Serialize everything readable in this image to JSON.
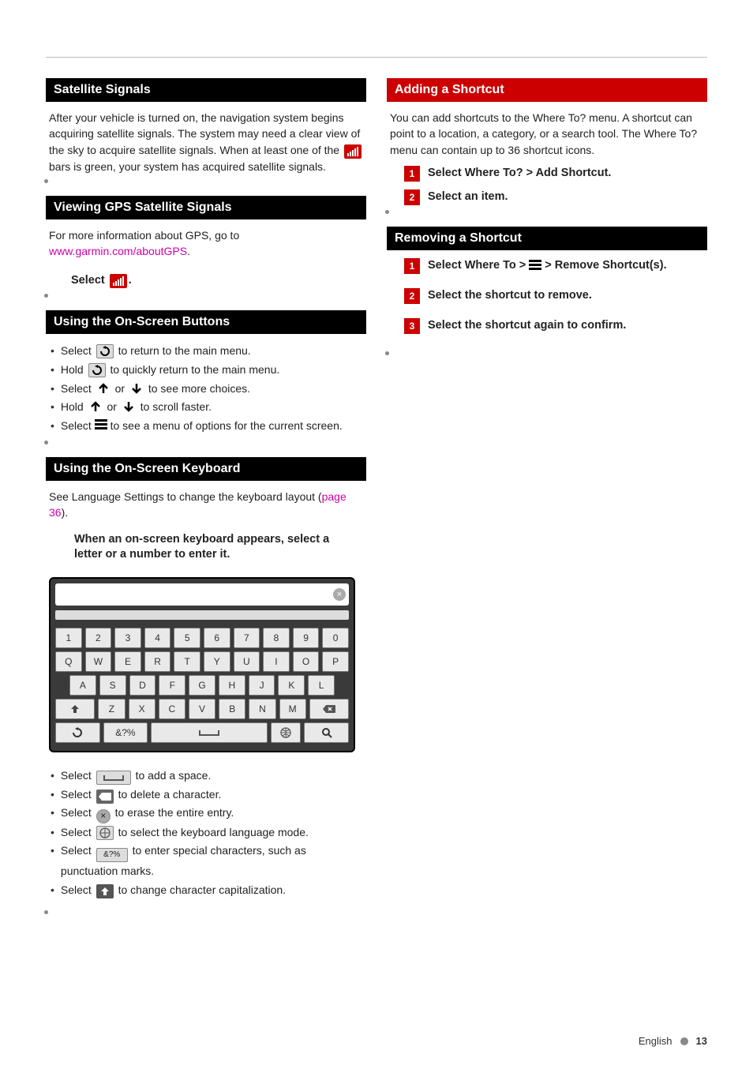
{
  "left": {
    "satSignals": {
      "title": "Satellite Signals",
      "body_a": "After your vehicle is turned on, the navigation system begins acquiring satellite signals. The system may need a clear view of the sky to acquire satellite signals. When at least one of the",
      "body_b": "bars is green, your system has acquired satellite signals."
    },
    "viewGps": {
      "title": "Viewing GPS Satellite Signals",
      "body": "For more information about GPS, go to ",
      "link": "www.garmin.com/aboutGPS",
      "step": "Select"
    },
    "onScreenBtns": {
      "title": "Using the On-Screen Buttons",
      "items": [
        {
          "a": "Select",
          "b": "to return to the main menu."
        },
        {
          "a": "Hold",
          "b": "to quickly return to the main menu."
        },
        {
          "a": "Select",
          "or": "or",
          "b": "to see more choices."
        },
        {
          "a": "Hold",
          "or": "or",
          "b": "to scroll faster."
        },
        {
          "a": "Select",
          "b": "to see a menu of options for the current screen."
        }
      ]
    },
    "keyboard": {
      "title": "Using the On-Screen Keyboard",
      "body_a": "See Language Settings to change the keyboard layout",
      "link": "page 36",
      "instruction": "When an on-screen keyboard appears, select a letter or a number to enter it.",
      "symKey": "&?%",
      "rows": [
        [
          "1",
          "2",
          "3",
          "4",
          "5",
          "6",
          "7",
          "8",
          "9",
          "0"
        ],
        [
          "Q",
          "W",
          "E",
          "R",
          "T",
          "Y",
          "U",
          "I",
          "O",
          "P"
        ],
        [
          "A",
          "S",
          "D",
          "F",
          "G",
          "H",
          "J",
          "K",
          "L"
        ],
        [
          "Z",
          "X",
          "C",
          "V",
          "B",
          "N",
          "M"
        ]
      ],
      "notes": [
        {
          "a": "Select",
          "b": "to add a space."
        },
        {
          "a": "Select",
          "b": "to delete a character."
        },
        {
          "a": "Select",
          "b": "to erase the entire entry."
        },
        {
          "a": "Select",
          "b": "to select the keyboard language mode."
        },
        {
          "a": "Select",
          "b": "to enter special characters, such as punctuation marks."
        },
        {
          "a": "Select",
          "b": "to change character capitalization."
        }
      ]
    }
  },
  "right": {
    "addShortcut": {
      "title": "Adding a Shortcut",
      "body": "You can add shortcuts to the Where To? menu. A shortcut can point to a location, a category, or a search tool. The Where To? menu can contain up to 36 shortcut icons.",
      "steps": [
        "Select Where To? > Add Shortcut.",
        "Select an item."
      ]
    },
    "removeShortcut": {
      "title": "Removing a Shortcut",
      "steps": [
        {
          "a": "Select Where To >",
          "b": "> Remove Shortcut(s)."
        },
        "Select the shortcut to remove.",
        "Select the shortcut again to confirm."
      ]
    }
  },
  "footer": {
    "language": "English",
    "page": "13"
  }
}
